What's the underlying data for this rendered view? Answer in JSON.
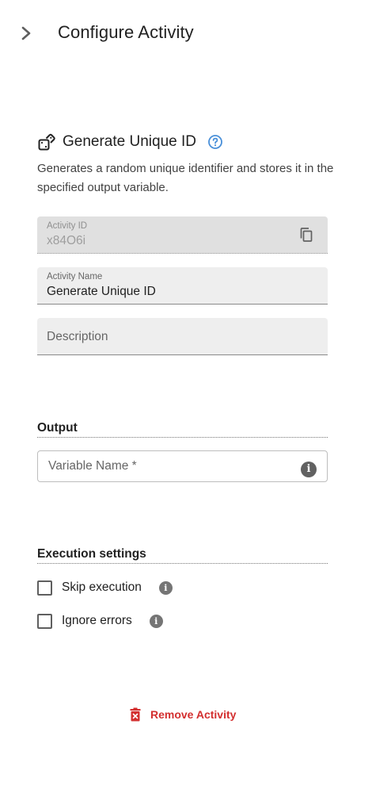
{
  "header": {
    "title": "Configure Activity",
    "collapse_icon": "chevron-right-icon"
  },
  "activity": {
    "icon": "dice-icon",
    "title": "Generate Unique ID",
    "help_icon": "help-circle-icon",
    "description": "Generates a random unique identifier and stores it in the specified output variable."
  },
  "fields": {
    "activity_id": {
      "label": "Activity ID",
      "value": "x84O6i",
      "copy_icon": "copy-icon"
    },
    "activity_name": {
      "label": "Activity Name",
      "value": "Generate Unique ID"
    },
    "description": {
      "placeholder": "Description"
    }
  },
  "output": {
    "section_title": "Output",
    "variable_name": {
      "placeholder": "Variable Name *",
      "info_icon": "info-icon"
    }
  },
  "execution": {
    "section_title": "Execution settings",
    "options": [
      {
        "label": "Skip execution",
        "checked": false
      },
      {
        "label": "Ignore errors",
        "checked": false
      }
    ]
  },
  "actions": {
    "remove_label": "Remove Activity",
    "remove_icon": "trash-icon"
  },
  "colors": {
    "accent_help": "#4a90d9",
    "danger": "#d32f2f",
    "field_bg": "#eeeeee",
    "disabled_bg": "#e0e0e0"
  }
}
